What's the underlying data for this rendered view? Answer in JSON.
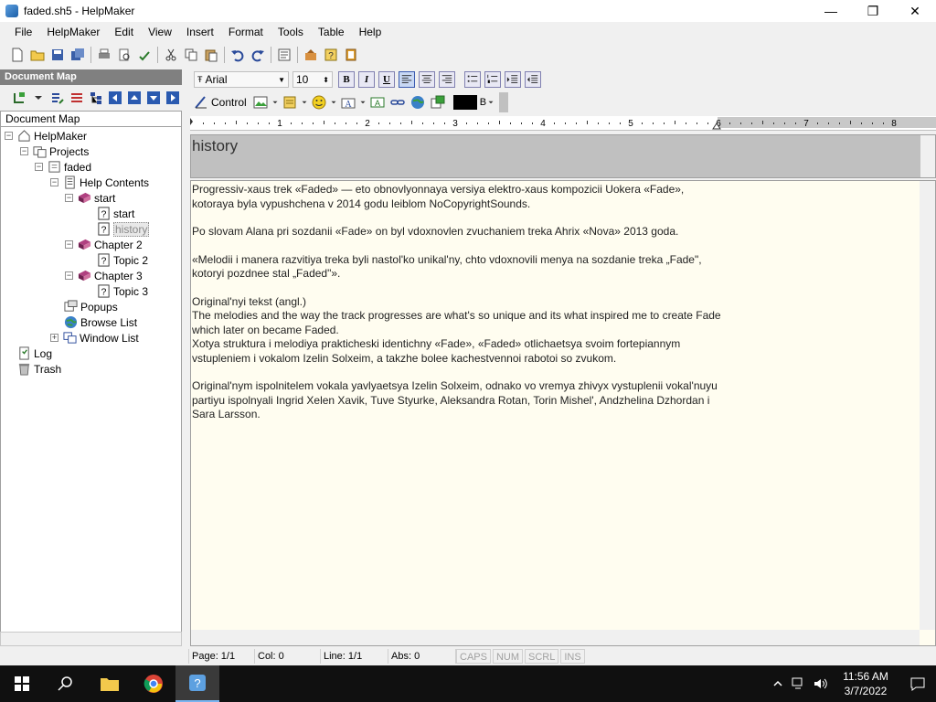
{
  "window": {
    "title": "faded.sh5 - HelpMaker",
    "minimize": "—",
    "maximize": "❐",
    "close": "✕"
  },
  "menu": [
    {
      "label": "File"
    },
    {
      "label": "HelpMaker"
    },
    {
      "label": "Edit"
    },
    {
      "label": "View"
    },
    {
      "label": "Insert"
    },
    {
      "label": "Format"
    },
    {
      "label": "Tools"
    },
    {
      "label": "Table"
    },
    {
      "label": "Help"
    }
  ],
  "docmap": {
    "header": "Document Map",
    "label": "Document Map",
    "tree": {
      "root": "HelpMaker",
      "projects": "Projects",
      "faded": "faded",
      "help_contents": "Help Contents",
      "start_book": "start",
      "start_topic": "start",
      "history_topic": "history",
      "chapter2": "Chapter 2",
      "topic2": "Topic 2",
      "chapter3": "Chapter 3",
      "topic3": "Topic 3",
      "popups": "Popups",
      "browse_list": "Browse List",
      "window_list": "Window List",
      "log": "Log",
      "trash": "Trash"
    }
  },
  "format": {
    "font": "Arial",
    "size": "10",
    "bold": "B",
    "italic": "I",
    "underline": "U",
    "control_label": "Control",
    "color_label": "B"
  },
  "ruler": {
    "marks": [
      "1",
      "2",
      "3",
      "4",
      "5",
      "6",
      "7",
      "8"
    ]
  },
  "topic": {
    "title": "history",
    "p1": "Progressiv-xaus trek «Faded» — eto obnovlyonnaya versiya elektro-xaus kompozicii Uokera «Fade», kotoraya byla vypushchena v 2014 godu leiblom NoCopyrightSounds.",
    "p2": "Po slovam Alana pri sozdanii «Fade» on byl vdoxnovlen zvuchaniem treka Ahrix «Nova» 2013 goda.",
    "p3": "«Melodii i manera razvitiya treka byli nastol'ko unikal'ny, chto vdoxnovili menya na sozdanie treka „Fade\", kotoryi pozdnee stal „Faded\"».",
    "p4a": "Original'nyi tekst (angl.)",
    "p4b": "The melodies and the way the track progresses are what's so unique and its what inspired me to create Fade which later on became Faded.",
    "p4c": "Xotya struktura i melodiya prakticheski identichny «Fade», «Faded» otlichaetsya svoim fortepiannym vstupleniem i vokalom Izelin Solxeim, a takzhe bolee kachestvennoi rabotoi so zvukom.",
    "p5": "Original'nym ispolnitelem vokala yavlyaetsya Izelin Solxeim, odnako vo vremya zhivyx vystuplenii vokal'nuyu partiyu ispolnyali Ingrid Xelen Xavik, Tuve Styurke, Aleksandra Rotan, Torin Mishel', Andzhelina Dzhordan i Sara Larsson."
  },
  "status": {
    "page": "Page: 1/1",
    "col": "Col: 0",
    "line": "Line: 1/1",
    "abs": "Abs: 0",
    "caps": "CAPS",
    "num": "NUM",
    "scrl": "SCRL",
    "ins": "INS"
  },
  "taskbar": {
    "time": "11:56 AM",
    "date": "3/7/2022"
  }
}
